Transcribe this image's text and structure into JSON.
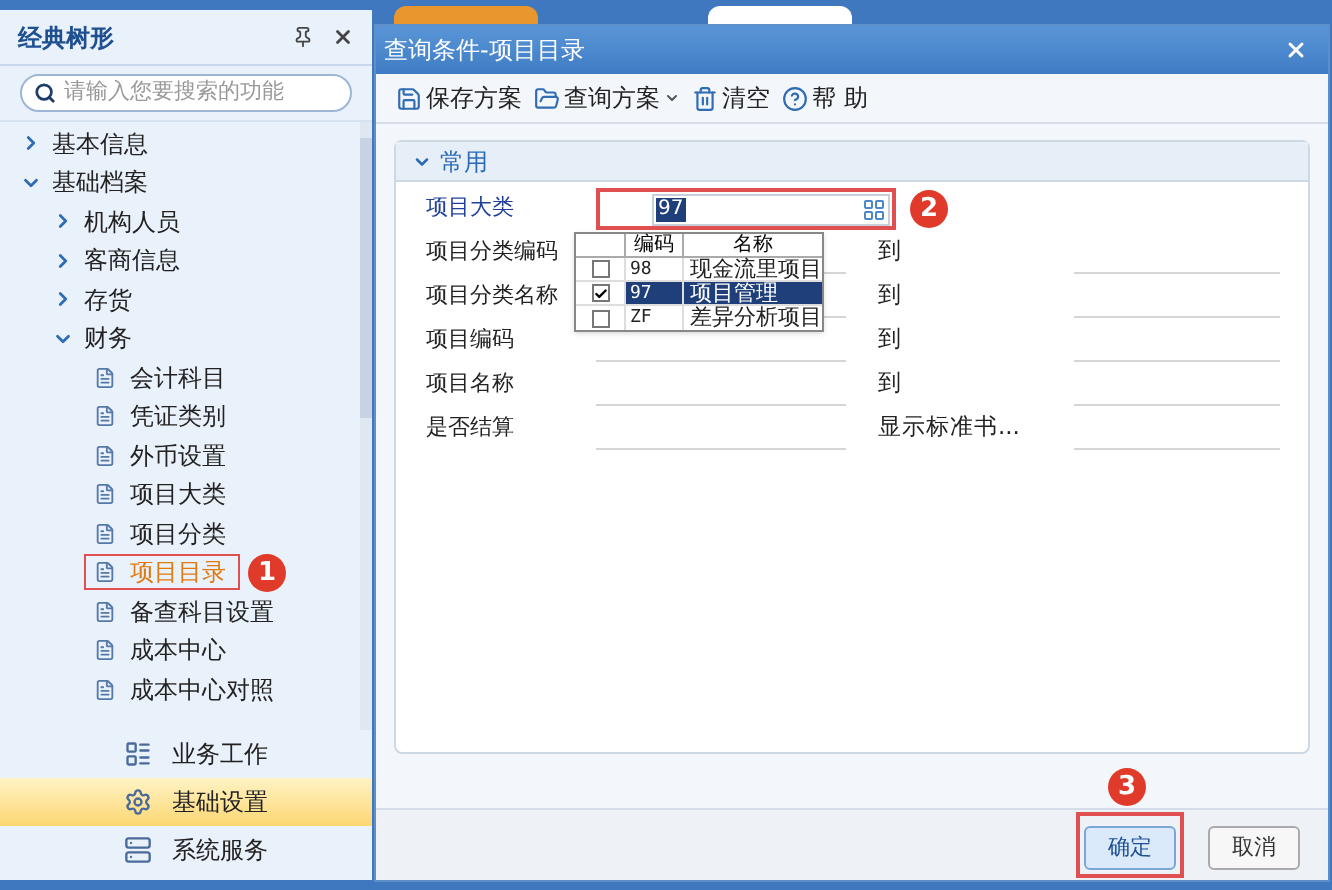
{
  "sidebar": {
    "title": "经典树形",
    "search": {
      "placeholder": "请输入您要搜索的功能"
    },
    "tree": [
      {
        "kind": "folder",
        "label": "基本信息",
        "expanded": false
      },
      {
        "kind": "folder",
        "label": "基础档案",
        "expanded": true,
        "children": [
          {
            "kind": "folder",
            "label": "机构人员",
            "expanded": false
          },
          {
            "kind": "folder",
            "label": "客商信息",
            "expanded": false
          },
          {
            "kind": "folder",
            "label": "存货",
            "expanded": false
          },
          {
            "kind": "folder",
            "label": "财务",
            "expanded": true,
            "children": [
              {
                "kind": "item",
                "label": "会计科目",
                "selected": false
              },
              {
                "kind": "item",
                "label": "凭证类别",
                "selected": false
              },
              {
                "kind": "item",
                "label": "外币设置",
                "selected": false
              },
              {
                "kind": "item",
                "label": "项目大类",
                "selected": false
              },
              {
                "kind": "item",
                "label": "项目分类",
                "selected": false
              },
              {
                "kind": "item",
                "label": "项目目录",
                "selected": true,
                "callout": "1"
              },
              {
                "kind": "item",
                "label": "备查科目设置",
                "selected": false
              },
              {
                "kind": "item",
                "label": "成本中心",
                "selected": false
              },
              {
                "kind": "item",
                "label": "成本中心对照",
                "selected": false
              }
            ]
          }
        ]
      }
    ],
    "nav": [
      {
        "label": "业务工作",
        "selected": false
      },
      {
        "label": "基础设置",
        "selected": true
      },
      {
        "label": "系统服务",
        "selected": false
      }
    ]
  },
  "dialog": {
    "title": "查询条件-项目目录",
    "toolbar": [
      {
        "label": "保存方案",
        "has_menu": false
      },
      {
        "label": "查询方案",
        "has_menu": true
      },
      {
        "label": "清空",
        "has_menu": false
      },
      {
        "label": "帮 助",
        "has_menu": false
      }
    ],
    "section": {
      "label": "常用",
      "expanded": true
    },
    "fields": [
      {
        "kind": "lookup",
        "label": "项目大类",
        "value": "97",
        "callout": "2"
      },
      {
        "kind": "range",
        "label": "项目分类编码",
        "right_label": "到"
      },
      {
        "kind": "range",
        "label": "项目分类名称",
        "right_label": "到"
      },
      {
        "kind": "range",
        "label": "项目编码",
        "right_label": "到"
      },
      {
        "kind": "range",
        "label": "项目名称",
        "right_label": "到"
      },
      {
        "kind": "range",
        "label": "是否结算",
        "right_label": "显示标准书..."
      }
    ],
    "dropdown": {
      "columns": [
        "编码",
        "名称"
      ],
      "rows": [
        {
          "code": "98",
          "name": "现金流里项目",
          "checked": false,
          "selected": false
        },
        {
          "code": "97",
          "name": "项目管理",
          "checked": true,
          "selected": true
        },
        {
          "code": "ZF",
          "name": "差异分析项目",
          "checked": false,
          "selected": false
        }
      ]
    },
    "buttons": [
      {
        "label": "确定",
        "primary": true,
        "callout": "3"
      },
      {
        "label": "取消",
        "primary": false
      }
    ]
  }
}
